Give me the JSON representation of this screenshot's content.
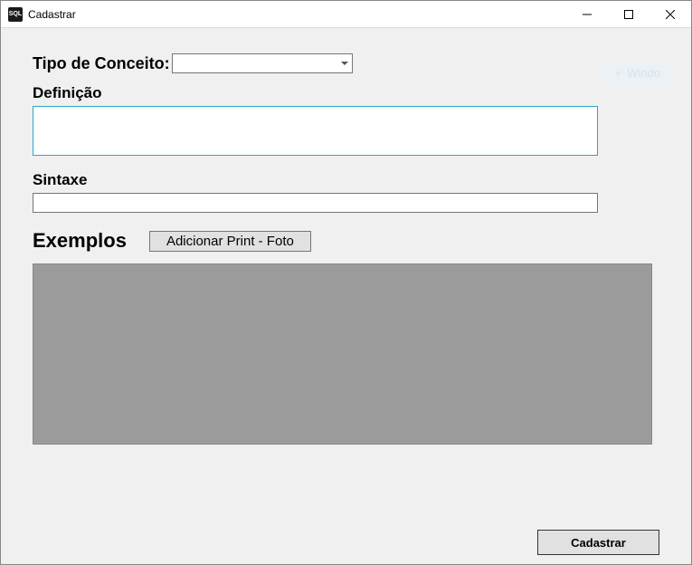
{
  "window": {
    "title": "Cadastrar",
    "icon_text": "SQL"
  },
  "ghost_button": "Windo",
  "form": {
    "tipo_label": "Tipo de Conceito:",
    "tipo_value": "",
    "definicao_label": "Definição",
    "definicao_value": "",
    "sintaxe_label": "Sintaxe",
    "sintaxe_value": "",
    "exemplos_label": "Exemplos",
    "add_print_label": "Adicionar Print - Foto"
  },
  "footer": {
    "submit_label": "Cadastrar"
  }
}
